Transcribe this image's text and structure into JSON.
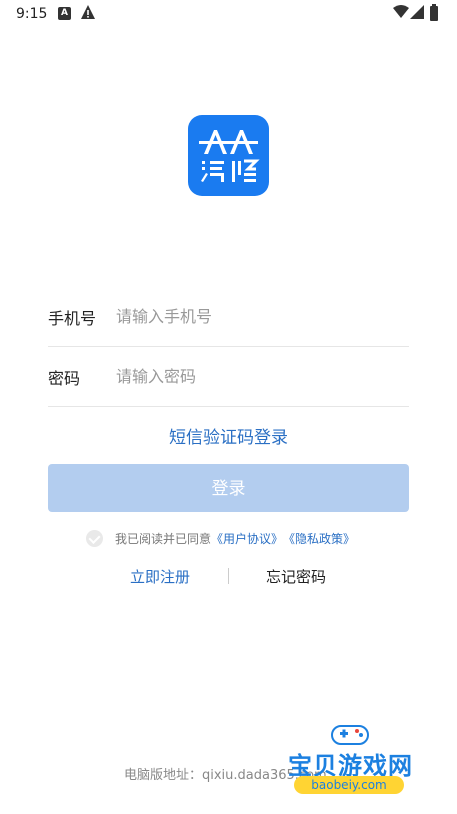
{
  "status_bar": {
    "time": "9:15",
    "icon_a": "A",
    "icons": [
      "notification-a-icon",
      "warning-icon",
      "wifi-icon",
      "signal-icon",
      "battery-icon"
    ]
  },
  "logo": {
    "text": "AA 汽修",
    "icon": "app-logo",
    "color": "#1a7bf0"
  },
  "form": {
    "phone_label": "手机号",
    "phone_placeholder": "请输入手机号",
    "password_label": "密码",
    "password_placeholder": "请输入密码"
  },
  "sms_login_label": "短信验证码登录",
  "login_button_label": "登录",
  "agreement": {
    "prefix": "我已阅读并已同意",
    "user_agreement": "《用户协议》",
    "privacy_policy": "《隐私政策》"
  },
  "links": {
    "register": "立即注册",
    "forgot_password": "忘记密码"
  },
  "footer": {
    "pc_address": "电脑版地址：qixiu.dada365.com"
  },
  "watermark": {
    "title": "宝贝游戏网",
    "subtitle": "baobeiy.com"
  },
  "colors": {
    "accent": "#2a6fc4",
    "button_disabled": "#b3cdef",
    "logo_bg": "#1a7bf0"
  }
}
